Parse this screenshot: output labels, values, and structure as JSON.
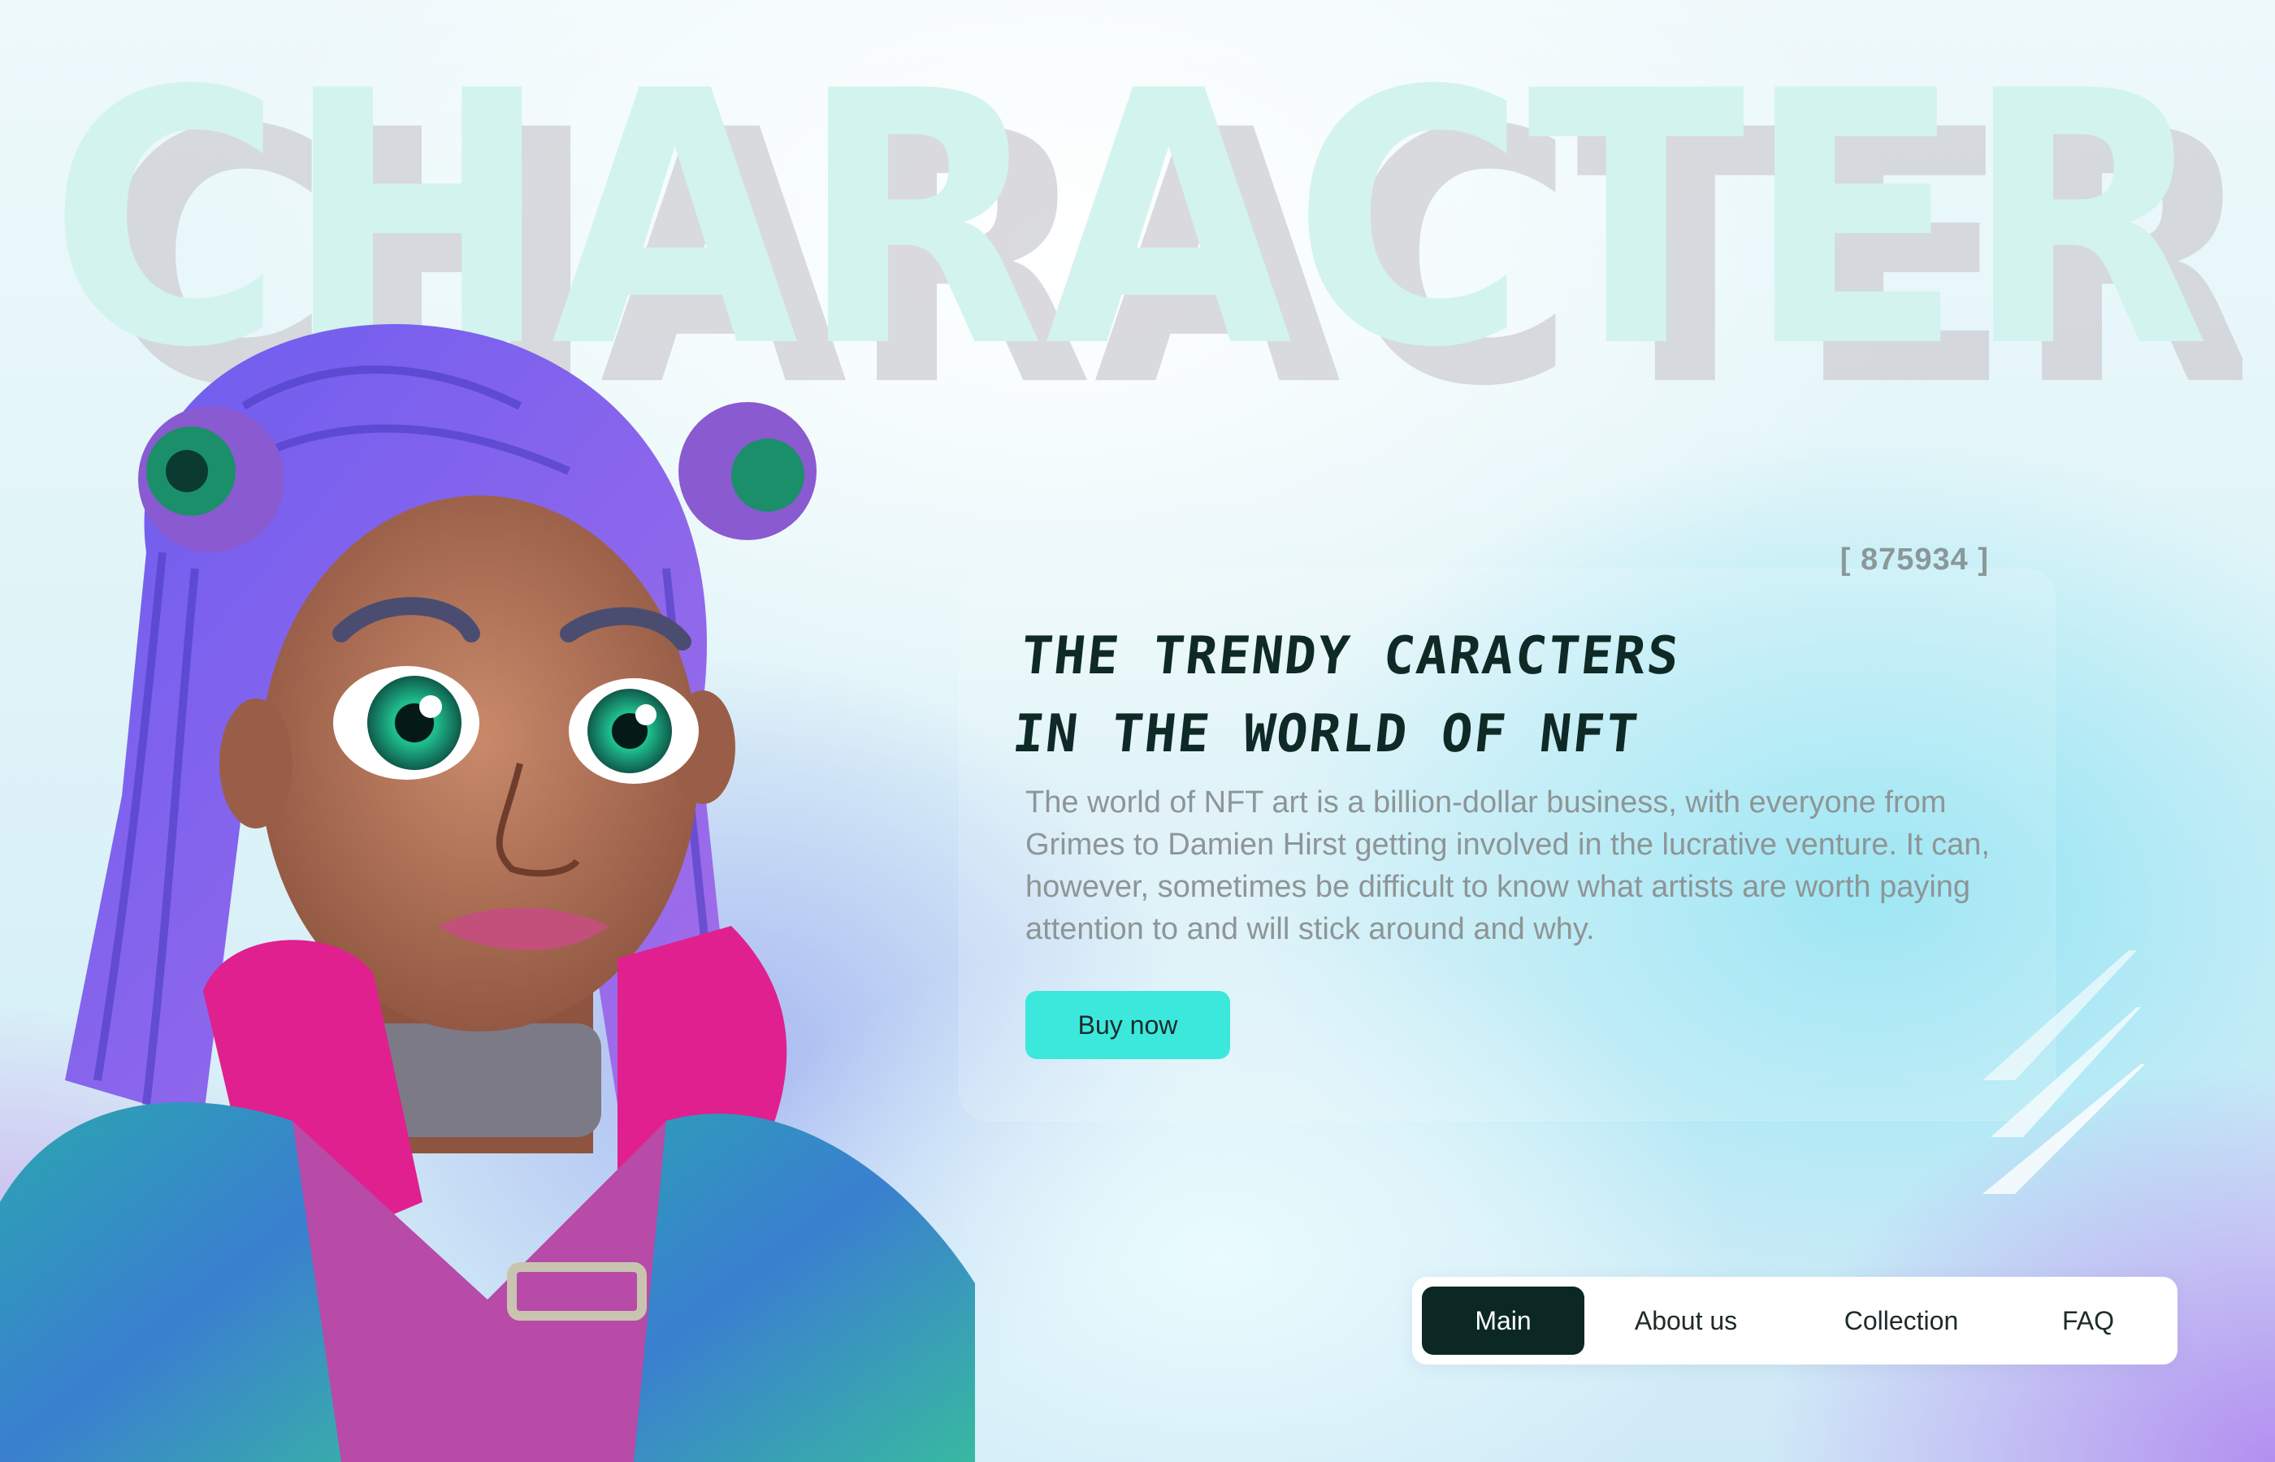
{
  "hero": {
    "background_word": "CHARACTER",
    "token_id": "[ 875934 ]",
    "headline_line1": "THE TRENDY CARACTERS",
    "headline_line2": "IN THE WORLD OF NFT",
    "description": "The world of NFT art is a billion-dollar business, with everyone from Grimes to Damien Hirst getting involved in the lucrative venture. It can, however, sometimes be difficult to know what artists are worth paying attention to and will stick around and why.",
    "buy_button_label": "Buy now"
  },
  "nav": {
    "items": [
      {
        "label": "Main",
        "active": true
      },
      {
        "label": "About us",
        "active": false
      },
      {
        "label": "Collection",
        "active": false
      },
      {
        "label": "FAQ",
        "active": false
      }
    ]
  },
  "illustration": {
    "subject": "3D character girl with purple braided hair and headphones"
  },
  "colors": {
    "accent": "#3ce8dc",
    "dark": "#0c2825",
    "bg_word": "#d3f3ee",
    "text_muted": "#8e9596"
  }
}
